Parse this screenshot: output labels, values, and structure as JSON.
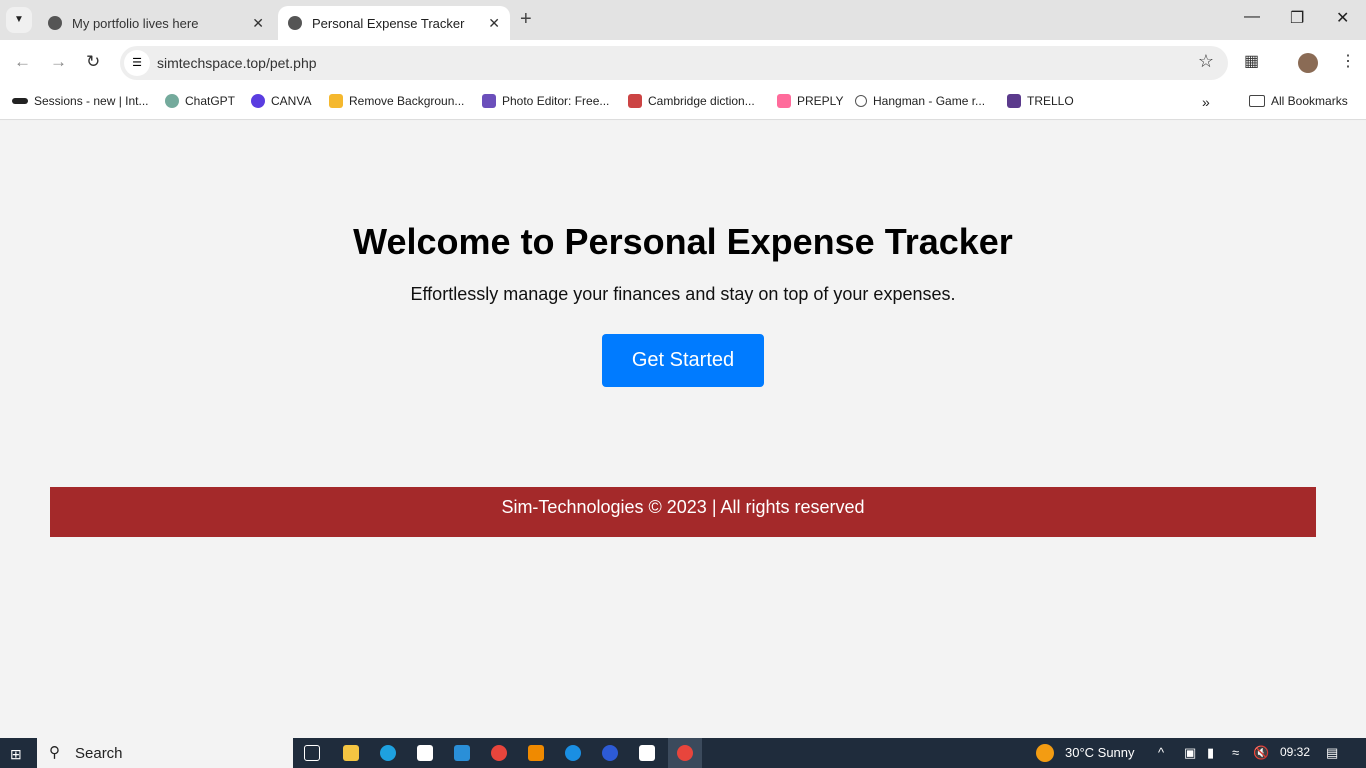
{
  "browser": {
    "tabs": [
      {
        "title": "My portfolio lives here",
        "active": false
      },
      {
        "title": "Personal Expense Tracker",
        "active": true
      }
    ],
    "url": "simtechspace.top/pet.php",
    "bookmarks": [
      "Sessions - new | Int...",
      "ChatGPT",
      "CANVA",
      "Remove Backgroun...",
      "Photo Editor: Free...",
      "Cambridge diction...",
      "PREPLY",
      "Hangman - Game r...",
      "TRELLO"
    ],
    "all_bookmarks": "All Bookmarks"
  },
  "page": {
    "title": "Welcome to Personal Expense Tracker",
    "subtitle": "Effortlessly manage your finances and stay on top of your expenses.",
    "cta": "Get Started",
    "footer": "Sim-Technologies © 2023 | All rights reserved",
    "colors": {
      "button": "#007bff",
      "footer": "#a4292a"
    }
  },
  "taskbar": {
    "search": "Search",
    "weather": "30°C  Sunny",
    "time": "09:32"
  }
}
